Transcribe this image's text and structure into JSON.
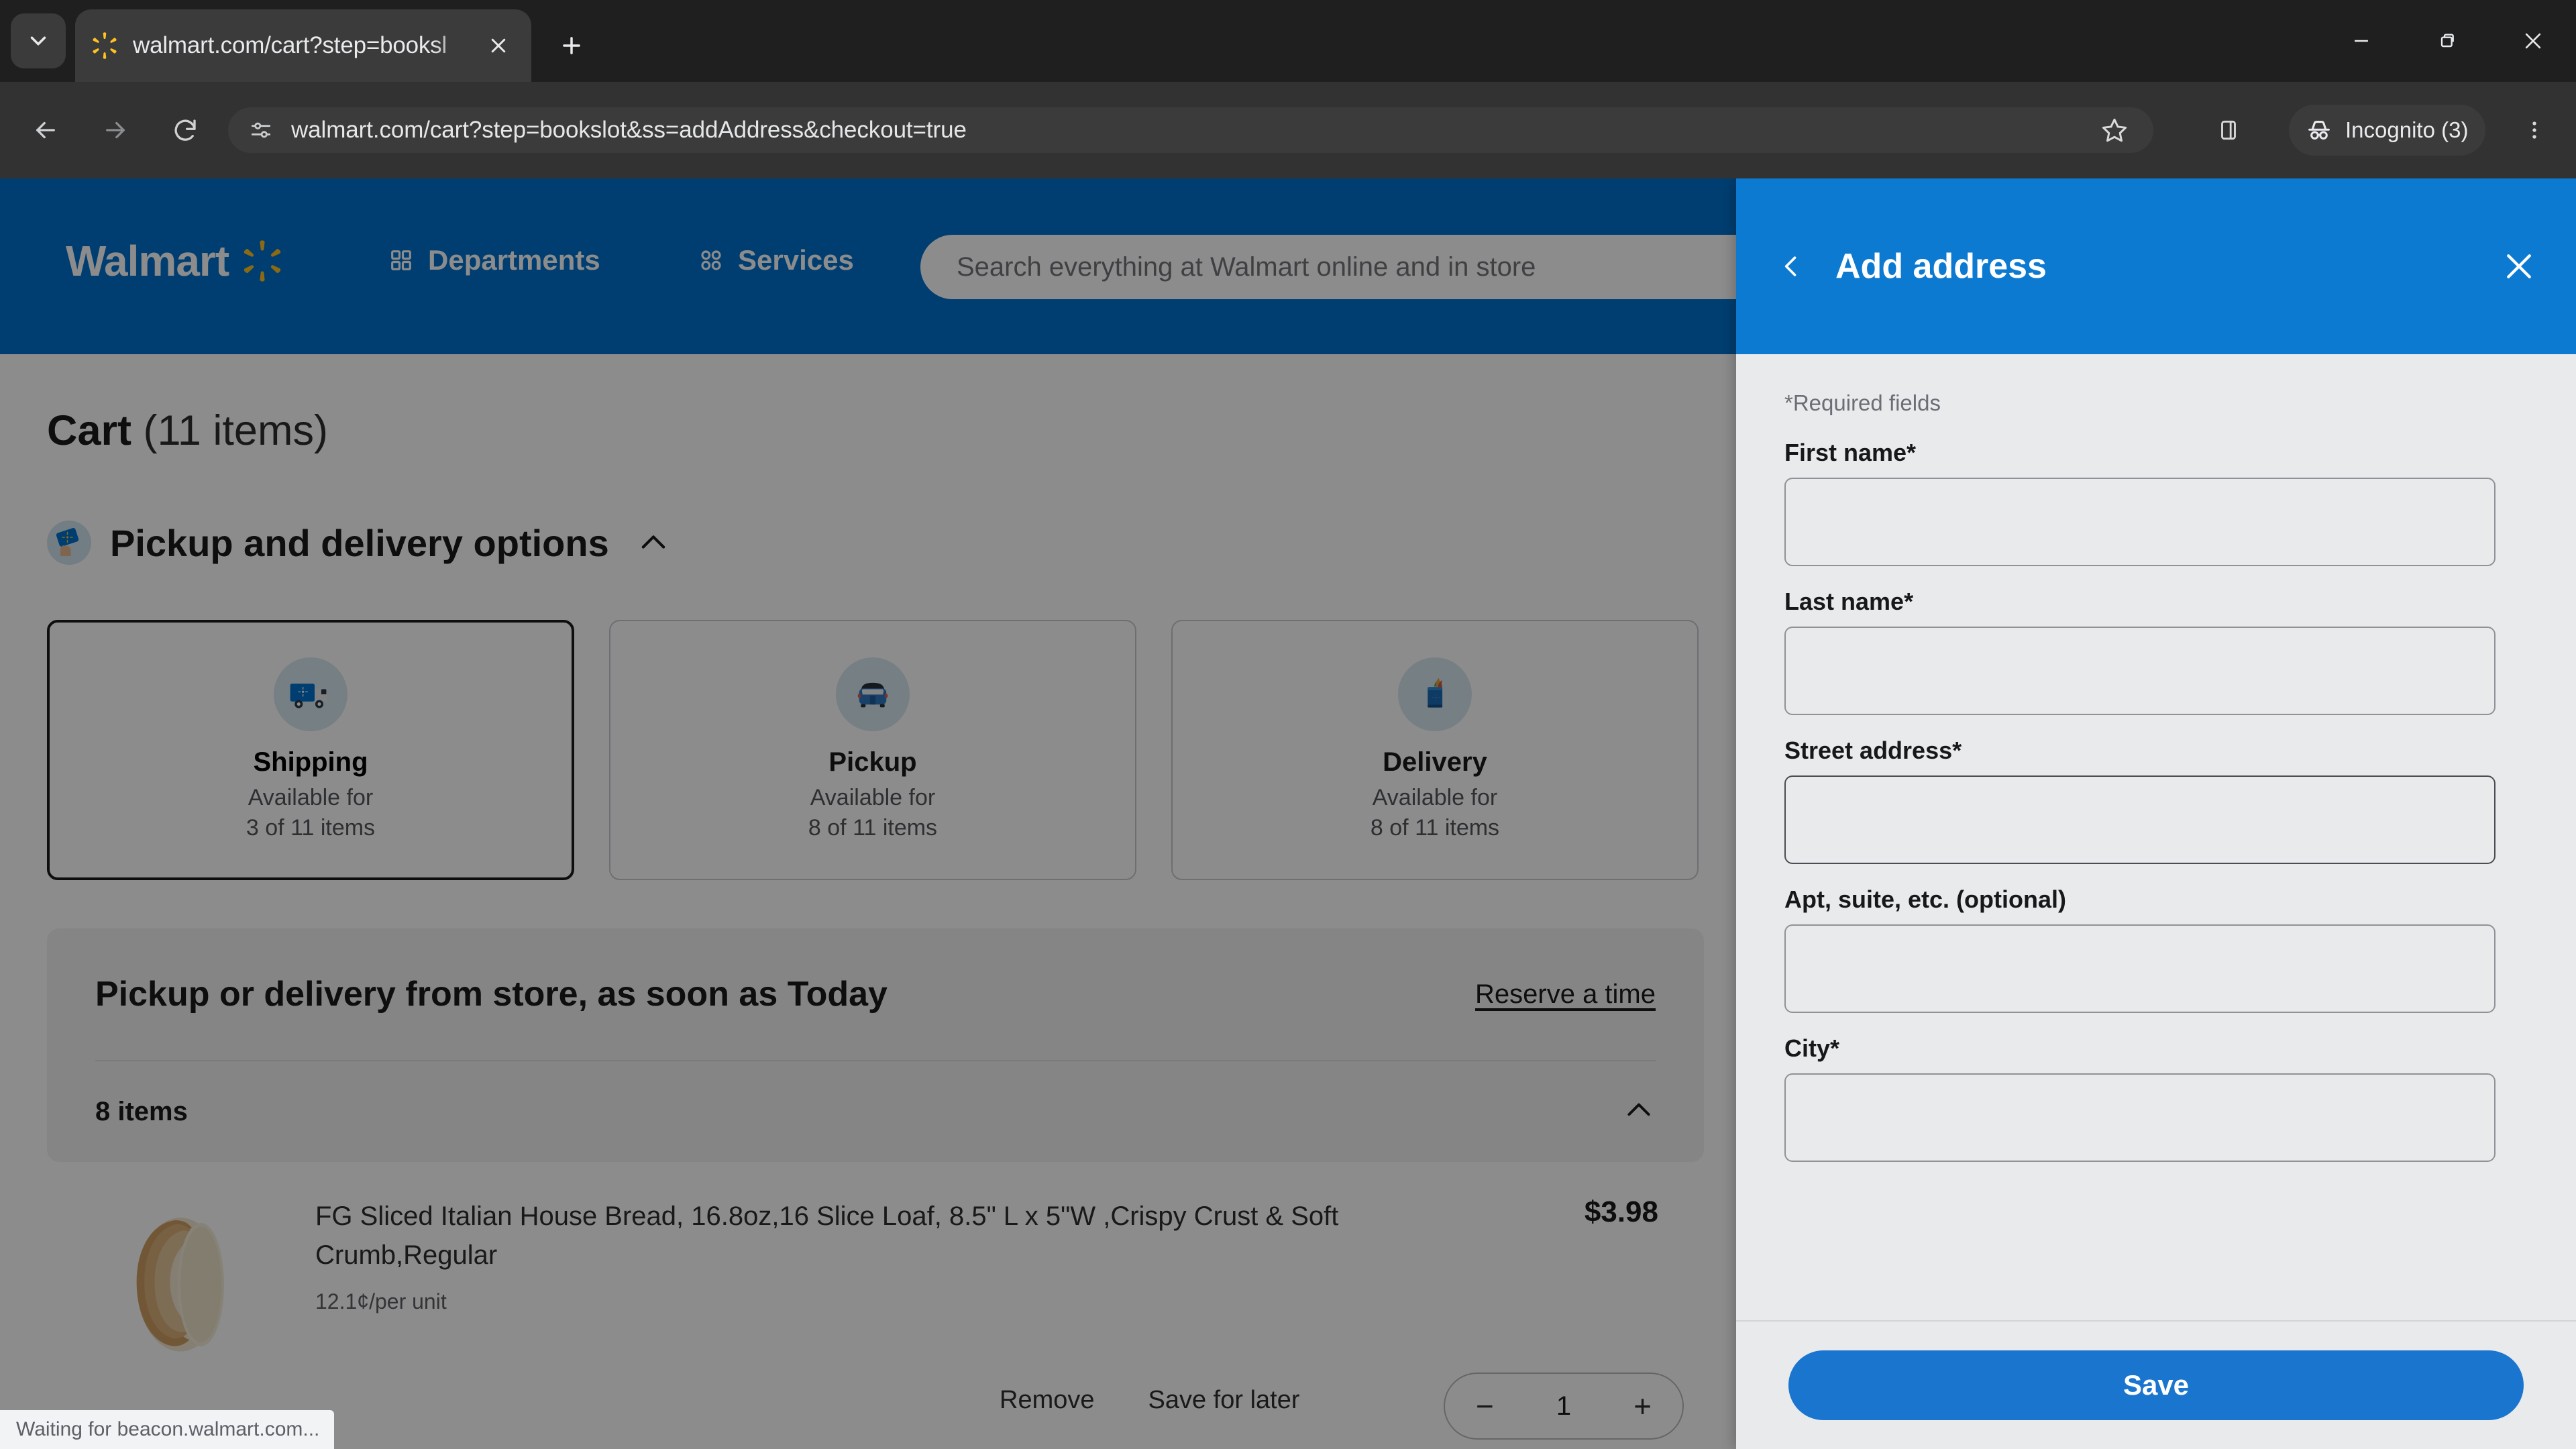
{
  "browser": {
    "tab": {
      "title": "walmart.com/cart?step=booksl",
      "favicon_icon": "walmart-spark-icon",
      "close_icon": "close-icon"
    },
    "tab_search_icon": "chevron-down-icon",
    "new_tab_icon": "plus-icon",
    "window_controls": {
      "minimize_icon": "minimize-icon",
      "maximize_icon": "restore-icon",
      "close_icon": "close-icon"
    },
    "nav": {
      "back_icon": "arrow-left-icon",
      "forward_icon": "arrow-right-icon",
      "reload_icon": "reload-icon"
    },
    "omnibox": {
      "site_info_icon": "page-settings-icon",
      "url": "walmart.com/cart?step=bookslot&ss=addAddress&checkout=true"
    },
    "toolbar": {
      "bookmark_icon": "star-icon",
      "side_panel_icon": "side-panel-icon",
      "incognito_label": "Incognito (3)",
      "incognito_icon": "incognito-hat-icon",
      "menu_icon": "kebab-menu-icon"
    }
  },
  "site_header": {
    "brand": "Walmart",
    "spark_icon": "walmart-spark-icon",
    "departments_label": "Departments",
    "departments_icon": "grid-icon",
    "services_label": "Services",
    "services_icon": "circles-icon",
    "search_placeholder": "Search everything at Walmart online and in store"
  },
  "cart": {
    "title": "Cart",
    "item_count_label": "(11 items)",
    "options_section": {
      "title": "Pickup and delivery options",
      "icon": "walmart-card-hand-icon",
      "collapse_icon": "chevron-up-icon"
    },
    "fulfillment_options": [
      {
        "name": "Shipping",
        "availability_line1": "Available for",
        "availability_line2": "3 of 11 items",
        "icon": "delivery-truck-icon",
        "selected": true
      },
      {
        "name": "Pickup",
        "availability_line1": "Available for",
        "availability_line2": "8 of 11 items",
        "icon": "car-icon",
        "selected": false
      },
      {
        "name": "Delivery",
        "availability_line1": "Available for",
        "availability_line2": "8 of 11 items",
        "icon": "grocery-bag-icon",
        "selected": false
      }
    ],
    "slot": {
      "heading": "Pickup or delivery from store, as soon as Today",
      "reserve_link": "Reserve a time",
      "items_count": "8 items",
      "collapse_icon": "chevron-up-icon"
    },
    "product": {
      "name": "FG Sliced Italian House Bread, 16.8oz,16 Slice Loaf, 8.5\" L x 5\"W ,Crispy Crust & Soft Crumb,Regular",
      "unit_price": "12.1¢/per unit",
      "price": "$3.98",
      "remove_label": "Remove",
      "save_for_later_label": "Save for later",
      "quantity": "1",
      "minus_label": "−",
      "plus_label": "+",
      "thumbnail_icon": "sliced-bread-image"
    }
  },
  "status_bar": {
    "text": "Waiting for beacon.walmart.com..."
  },
  "drawer": {
    "title": "Add address",
    "back_icon": "chevron-left-icon",
    "close_icon": "close-icon",
    "required_note": "*Required fields",
    "fields": [
      {
        "label": "First name*",
        "value": "",
        "placeholder": ""
      },
      {
        "label": "Last name*",
        "value": "",
        "placeholder": ""
      },
      {
        "label": "Street address*",
        "value": "",
        "placeholder": ""
      },
      {
        "label": "Apt, suite, etc. (optional)",
        "value": "",
        "placeholder": ""
      },
      {
        "label": "City*",
        "value": "",
        "placeholder": ""
      }
    ],
    "save_label": "Save"
  },
  "colors": {
    "walmart_blue": "#0071ce",
    "drawer_blue": "#0d7ad1",
    "save_blue": "#1a75cf",
    "spark_yellow": "#ffc220",
    "chrome_dark": "#1f1f1f",
    "toolbar_dark": "#323232"
  }
}
